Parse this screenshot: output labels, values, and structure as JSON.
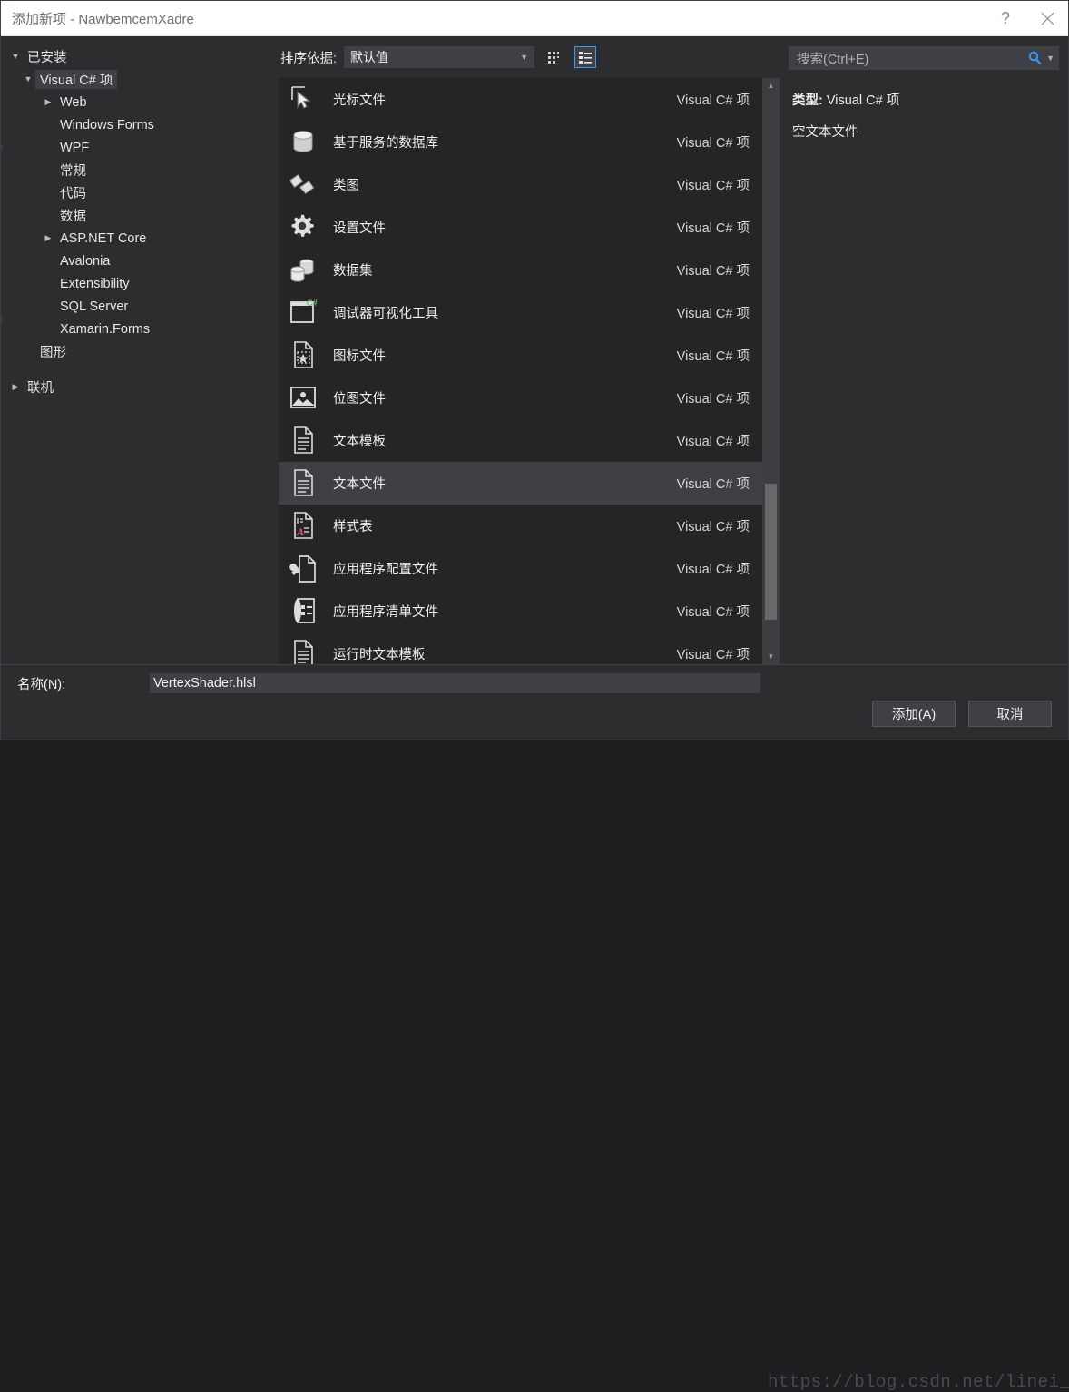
{
  "window": {
    "title": "添加新项 - NawbemcemXadre",
    "help_icon": "help-icon",
    "close_icon": "close-icon"
  },
  "tree": {
    "root_label": "已安装",
    "nodes": [
      {
        "label": "Visual C# 项",
        "level": 1,
        "expander": "expanded",
        "selected": true
      },
      {
        "label": "Web",
        "level": 2,
        "expander": "collapsed",
        "selected": false
      },
      {
        "label": "Windows Forms",
        "level": 2,
        "expander": "none",
        "selected": false
      },
      {
        "label": "WPF",
        "level": 2,
        "expander": "none",
        "selected": false
      },
      {
        "label": "常规",
        "level": 2,
        "expander": "none",
        "selected": false
      },
      {
        "label": "代码",
        "level": 2,
        "expander": "none",
        "selected": false
      },
      {
        "label": "数据",
        "level": 2,
        "expander": "none",
        "selected": false
      },
      {
        "label": "ASP.NET Core",
        "level": 2,
        "expander": "collapsed",
        "selected": false
      },
      {
        "label": "Avalonia",
        "level": 2,
        "expander": "none",
        "selected": false
      },
      {
        "label": "Extensibility",
        "level": 2,
        "expander": "none",
        "selected": false
      },
      {
        "label": "SQL Server",
        "level": 2,
        "expander": "none",
        "selected": false
      },
      {
        "label": "Xamarin.Forms",
        "level": 2,
        "expander": "none",
        "selected": false
      },
      {
        "label": "图形",
        "level": 1,
        "expander": "none",
        "selected": false
      }
    ],
    "online_label": "联机"
  },
  "toolbar": {
    "sort_label": "排序依据:",
    "sort_value": "默认值",
    "grid_view_icon": "grid-view-icon",
    "list_view_icon": "list-view-icon",
    "active_view": "list"
  },
  "list": {
    "items": [
      {
        "name": "光标文件",
        "kind": "Visual C# 项",
        "icon": "cursor-file-icon",
        "selected": false
      },
      {
        "name": "基于服务的数据库",
        "kind": "Visual C# 项",
        "icon": "database-icon",
        "selected": false
      },
      {
        "name": "类图",
        "kind": "Visual C# 项",
        "icon": "class-diagram-icon",
        "selected": false
      },
      {
        "name": "设置文件",
        "kind": "Visual C# 项",
        "icon": "settings-gear-icon",
        "selected": false
      },
      {
        "name": "数据集",
        "kind": "Visual C# 项",
        "icon": "dataset-icon",
        "selected": false
      },
      {
        "name": "调试器可视化工具",
        "kind": "Visual C# 项",
        "icon": "debugger-visualizer-icon",
        "selected": false
      },
      {
        "name": "图标文件",
        "kind": "Visual C# 项",
        "icon": "icon-file-icon",
        "selected": false
      },
      {
        "name": "位图文件",
        "kind": "Visual C# 项",
        "icon": "bitmap-file-icon",
        "selected": false
      },
      {
        "name": "文本模板",
        "kind": "Visual C# 项",
        "icon": "text-template-icon",
        "selected": false
      },
      {
        "name": "文本文件",
        "kind": "Visual C# 项",
        "icon": "text-file-icon",
        "selected": true
      },
      {
        "name": "样式表",
        "kind": "Visual C# 项",
        "icon": "stylesheet-icon",
        "selected": false
      },
      {
        "name": "应用程序配置文件",
        "kind": "Visual C# 项",
        "icon": "app-config-file-icon",
        "selected": false
      },
      {
        "name": "应用程序清单文件",
        "kind": "Visual C# 项",
        "icon": "app-manifest-file-icon",
        "selected": false
      },
      {
        "name": "运行时文本模板",
        "kind": "Visual C# 项",
        "icon": "runtime-text-template-icon",
        "selected": false
      }
    ]
  },
  "scrollbar": {
    "up_arrow_icon": "scroll-up-arrow-icon",
    "down_arrow_icon": "scroll-down-arrow-icon"
  },
  "search": {
    "placeholder": "搜索(Ctrl+E)",
    "search_icon": "search-icon",
    "dropdown_icon": "chevron-down-icon"
  },
  "details": {
    "type_key": "类型:",
    "type_value": "Visual C# 项",
    "description": "空文本文件"
  },
  "bottom": {
    "name_label": "名称(N):",
    "name_value": "VertexShader.hlsl",
    "add_button": "添加(A)",
    "cancel_button": "取消",
    "watermark": "https://blog.csdn.net/linei_gd"
  },
  "colors": {
    "accent": "#3399ff",
    "dialog_bg": "#2d2d30",
    "list_bg": "#252526",
    "selection": "#3f3f46",
    "titlebar_bg": "#ffffff"
  }
}
